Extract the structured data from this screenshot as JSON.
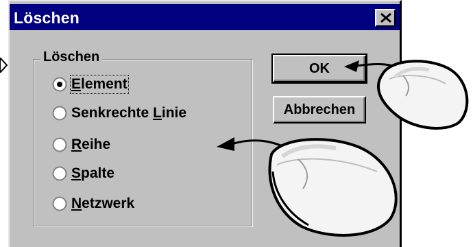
{
  "dialog": {
    "title": "Löschen",
    "close_icon": "close-icon",
    "group_label": "Löschen",
    "options": [
      {
        "pre": "",
        "key": "E",
        "post": "lement",
        "selected": true
      },
      {
        "pre": "Senkrechte ",
        "key": "L",
        "post": "inie",
        "selected": false
      },
      {
        "pre": "",
        "key": "R",
        "post": "eihe",
        "selected": false
      },
      {
        "pre": "",
        "key": "S",
        "post": "palte",
        "selected": false
      },
      {
        "pre": "",
        "key": "N",
        "post": "etzwerk",
        "selected": false
      }
    ],
    "ok_label": "OK",
    "cancel_label": "Abbrechen"
  },
  "colors": {
    "titlebar": "#000080",
    "face": "#c0c0c0"
  },
  "illustration": {
    "icons": [
      "mouse-icon",
      "arrow-icon"
    ]
  }
}
